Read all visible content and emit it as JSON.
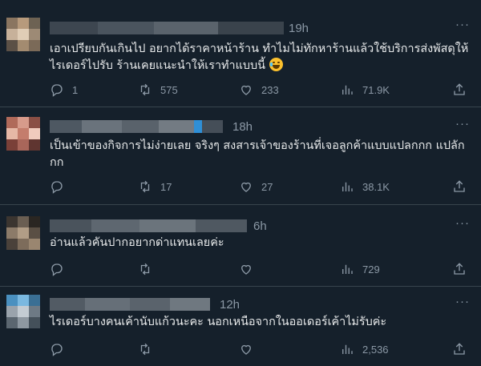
{
  "replies": [
    {
      "time": "19h",
      "text": "เอาเปรียบกันเกินไป อยากได้ราคาหน้าร้าน ทำไมไม่ทักหาร้านแล้วใช้บริการส่งพัสดุให้ไรเดอร์ไปรับ ร้านเคยแนะนำให้เราทำแบบนี้",
      "emoji": "face-with-tears-of-joy",
      "reply_count": "1",
      "retweet_count": "575",
      "like_count": "233",
      "view_count": "71.9K"
    },
    {
      "time": "18h",
      "text": "เป็นเข้าของกิจการไม่ง่ายเลย จริงๆ สงสารเจ้าของร้านที่เจอลูกค้าแบบแปลกกก แปลักกก",
      "reply_count": "",
      "retweet_count": "17",
      "like_count": "27",
      "view_count": "38.1K"
    },
    {
      "time": "6h",
      "text": "อ่านแล้วคันปากอยากด่าแทนเลยค่ะ",
      "reply_count": "",
      "retweet_count": "",
      "like_count": "",
      "view_count": "729"
    },
    {
      "time": "12h",
      "text": "ไรเดอร์บางคนเค้านับแก้วนะคะ นอกเหนือจากในออเดอร์เค้าไม่รับค่ะ",
      "reply_count": "",
      "retweet_count": "",
      "like_count": "",
      "view_count": "2,536"
    }
  ],
  "colors": {
    "background": "#15202b",
    "text": "#e7e9ea",
    "muted": "#8b98a5",
    "divider": "#38444d"
  },
  "icons": [
    "reply-icon",
    "retweet-icon",
    "like-icon",
    "views-icon",
    "share-icon",
    "more-icon"
  ]
}
